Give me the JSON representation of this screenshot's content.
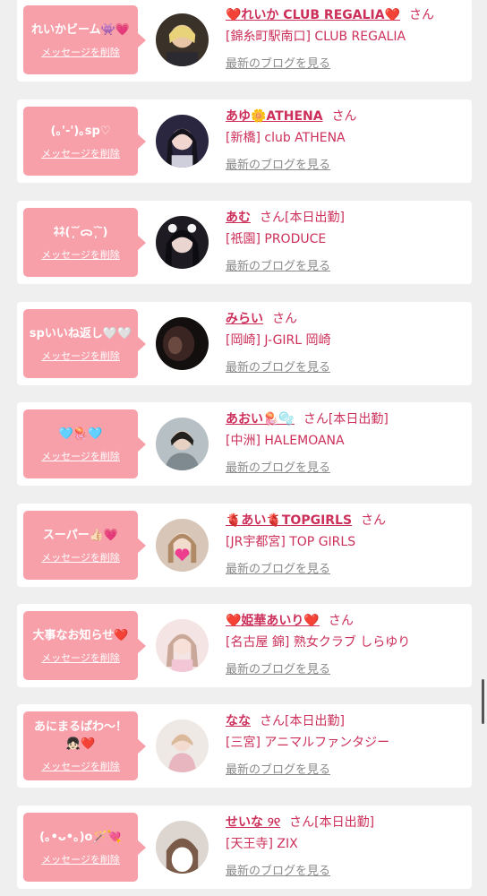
{
  "ui": {
    "delete_label": "メッセージを削除",
    "blog_label": "最新のブログを見る",
    "honorific": "さん"
  },
  "colors": {
    "bubble": "#f7a0aa",
    "accent": "#cc2f5a",
    "link_gray": "#8a8a8a",
    "background": "#efefef"
  },
  "messages": [
    {
      "message": "れいかビーム👾💗",
      "name": "❤️れいか CLUB REGALIA❤️",
      "suffix": "",
      "shop": "[錦糸町駅南口] CLUB REGALIA",
      "avatar_icon": "avatar-photo"
    },
    {
      "message": "(｡'-')｡sp♡",
      "name": "あゆ🌼ATHENA",
      "suffix": "",
      "shop": "[新橋] club ATHENA",
      "avatar_icon": "avatar-photo"
    },
    {
      "message": "ﾈﾈ(˘̩̩̩ ᷄ᯅ˘̩̩̩ ᷅)",
      "name": "あむ",
      "suffix": "[本日出勤]",
      "shop": "[祇園] PRODUCE",
      "avatar_icon": "avatar-photo"
    },
    {
      "message": "spいいね返し🤍🤍",
      "name": "みらい",
      "suffix": "",
      "shop": "[岡崎] J-GIRL 岡崎",
      "avatar_icon": "avatar-photo"
    },
    {
      "message": "🩵🪼🩵",
      "name": "あおい🪼🫧",
      "suffix": "[本日出勤]",
      "shop": "[中洲] HALEMOANA",
      "avatar_icon": "avatar-photo"
    },
    {
      "message": "スーパー👍🏻💗",
      "name": "🫀あい🫀TOPGIRLS",
      "suffix": "",
      "shop": "[JR宇都宮] TOP GIRLS",
      "avatar_icon": "avatar-photo"
    },
    {
      "message": "大事なお知らせ❤️",
      "name": "❤️姫華あいり❤️",
      "suffix": "",
      "shop": "[名古屋 錦] 熟女クラブ しらゆり",
      "avatar_icon": "avatar-photo"
    },
    {
      "message": "あにまるぱわ〜！👧🏻❤️",
      "name": "なな",
      "suffix": "[本日出勤]",
      "shop": "[三宮] アニマルファンタジー",
      "avatar_icon": "avatar-photo"
    },
    {
      "message": "(｡•ᴗ•｡)o🪄💘",
      "name": "せいな ୨୧",
      "suffix": "[本日出勤]",
      "shop": "[天王寺] ZIX",
      "avatar_icon": "avatar-photo"
    }
  ]
}
